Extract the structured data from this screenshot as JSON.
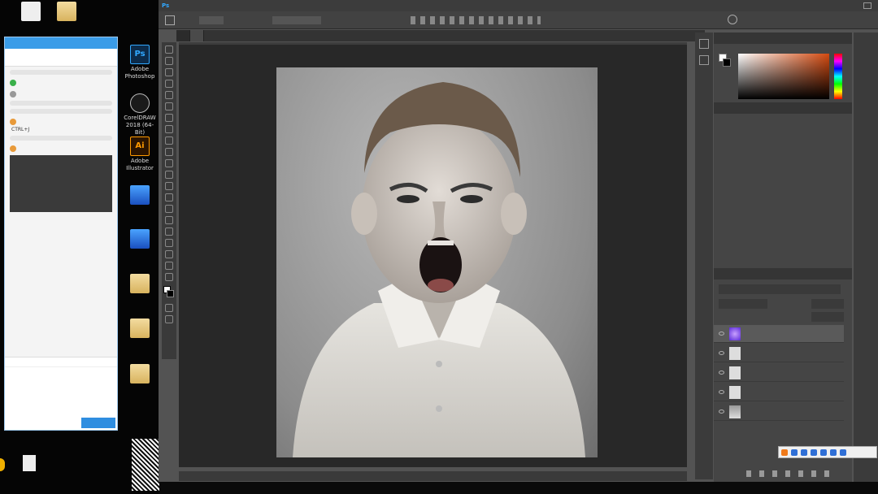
{
  "desktop": {
    "icons": [
      {
        "label": "",
        "kind": "doc"
      },
      {
        "label": "",
        "kind": "folder"
      },
      {
        "label": "",
        "kind": "folder"
      },
      {
        "label": "Adobe Photoshop",
        "kind": "ps"
      },
      {
        "label": "CorelDRAW 2018 (64-Bit)",
        "kind": "corel"
      },
      {
        "label": "Adobe Illustrator",
        "kind": "ai"
      },
      {
        "label": "",
        "kind": "blue"
      },
      {
        "label": "",
        "kind": "blue"
      },
      {
        "label": "",
        "kind": "folder"
      },
      {
        "label": "",
        "kind": "folder"
      },
      {
        "label": "",
        "kind": "folder"
      }
    ]
  },
  "chat": {
    "title": "",
    "tabs": [
      "",
      ""
    ],
    "messages": [
      {
        "type": "bubble",
        "text": ""
      },
      {
        "type": "user",
        "name": ""
      },
      {
        "type": "plain",
        "text": ""
      },
      {
        "type": "user",
        "name": ""
      },
      {
        "type": "bubble",
        "text": ""
      },
      {
        "type": "bubble",
        "text": ""
      },
      {
        "type": "user",
        "name": ""
      },
      {
        "type": "plain",
        "text": "CTRL+J"
      },
      {
        "type": "bubble",
        "text": ""
      },
      {
        "type": "user",
        "name": ""
      }
    ],
    "send_label": ""
  },
  "photoshop": {
    "app_badge": "Ps",
    "menus": [
      "",
      "",
      "",
      "",
      "",
      "",
      "",
      "",
      "",
      "",
      ""
    ],
    "tabs": [
      "",
      ""
    ],
    "status": "",
    "color_panel_tabs": [
      "",
      ""
    ],
    "layers_panel_tabs": [
      "",
      "",
      ""
    ],
    "layers": [
      {
        "name": "",
        "thumb": "glow",
        "selected": true
      },
      {
        "name": "",
        "thumb": "white",
        "selected": false
      },
      {
        "name": "",
        "thumb": "white",
        "selected": false
      },
      {
        "name": "",
        "thumb": "white",
        "selected": false
      },
      {
        "name": "",
        "thumb": "photo",
        "selected": false
      }
    ]
  }
}
